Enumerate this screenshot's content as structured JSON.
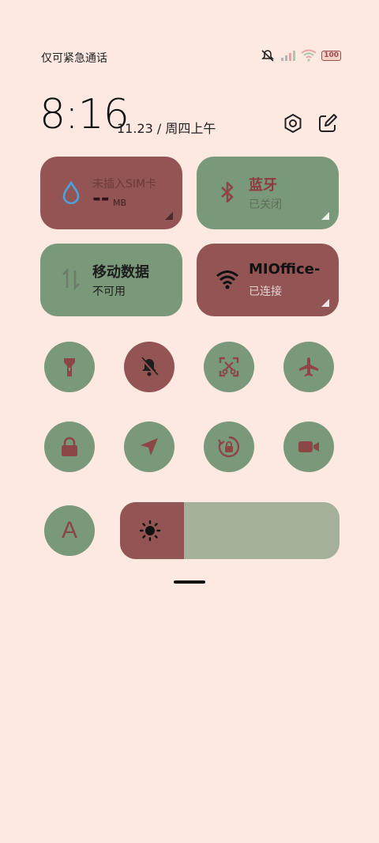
{
  "status": {
    "carrier": "仅可紧急通话",
    "battery": "100"
  },
  "header": {
    "time": "8:16",
    "date": "11.23 / 周四上午"
  },
  "tiles": {
    "data_usage": {
      "title": "未插入SIM卡",
      "value": "--",
      "unit": "MB"
    },
    "bluetooth": {
      "title": "蓝牙",
      "status": "已关闭"
    },
    "mobile_data": {
      "title": "移动数据",
      "status": "不可用"
    },
    "wifi": {
      "title": "MIOffice-",
      "status": "已连接"
    }
  },
  "toggles": [
    {
      "name": "flashlight-icon",
      "state": "off"
    },
    {
      "name": "mute-icon",
      "state": "on"
    },
    {
      "name": "screenshot-icon",
      "state": "off"
    },
    {
      "name": "airplane-icon",
      "state": "off"
    },
    {
      "name": "lock-icon",
      "state": "off"
    },
    {
      "name": "location-icon",
      "state": "off"
    },
    {
      "name": "rotation-lock-icon",
      "state": "off"
    },
    {
      "name": "screen-record-icon",
      "state": "off"
    }
  ],
  "brightness": {
    "auto_label": "A",
    "level_fraction": 0.29
  },
  "colors": {
    "active": "#935454",
    "inactive": "#7a987a",
    "background": "#fde9e1",
    "icon_accent": "#8c4646"
  }
}
